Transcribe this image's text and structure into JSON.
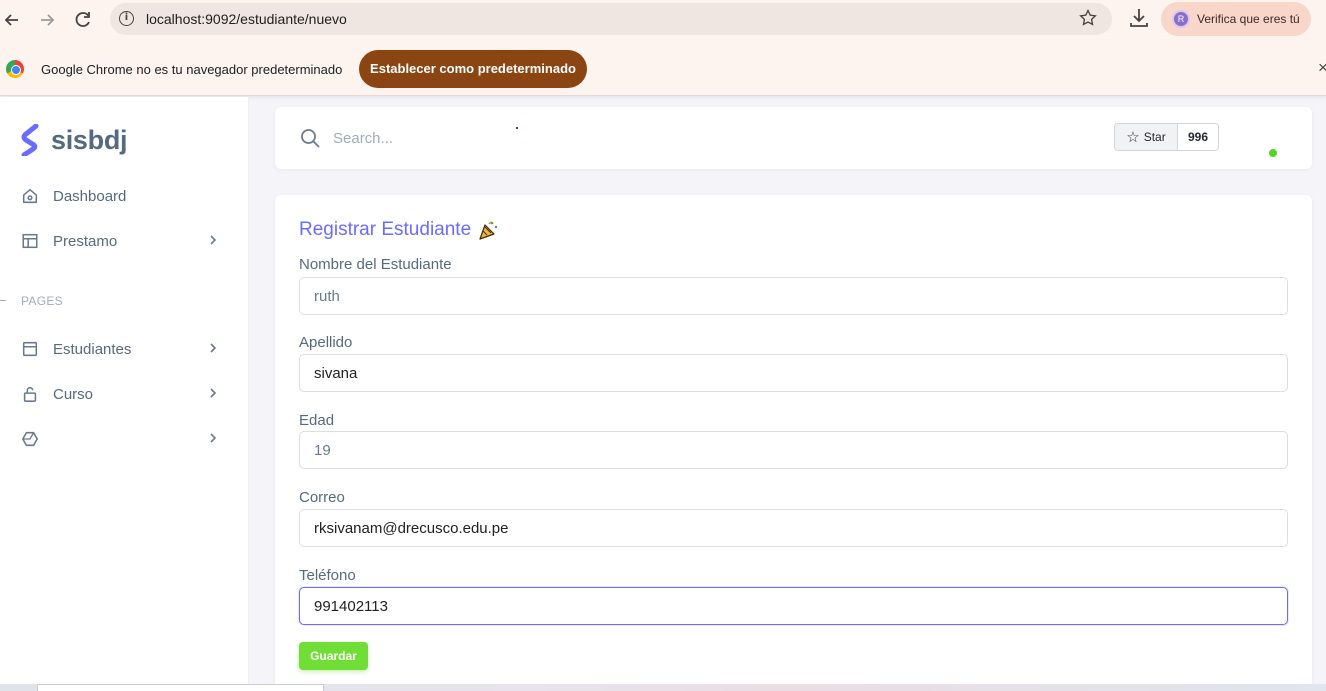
{
  "browser": {
    "url": "localhost:9092/estudiante/nuevo",
    "profile_chip_label": "Verifica que eres tú",
    "profile_initial": "R",
    "infobar_message": "Google Chrome no es tu navegador predeterminado",
    "infobar_button": "Establecer como predeterminado",
    "infobar_close": "×"
  },
  "sidebar": {
    "brand": "sisbdj",
    "items": [
      {
        "label": "Dashboard",
        "icon": "home-icon"
      },
      {
        "label": "Prestamo",
        "icon": "layout-icon"
      }
    ],
    "section_title": "PAGES",
    "page_items": [
      {
        "label": "Estudiantes",
        "icon": "window-icon"
      },
      {
        "label": "Curso",
        "icon": "lock-icon"
      },
      {
        "label": "",
        "icon": "cube-icon"
      }
    ]
  },
  "topbar": {
    "search_placeholder": "Search...",
    "star_label": "Star",
    "star_count": "996",
    "status_color": "#53d62a"
  },
  "form": {
    "title": "Registrar Estudiante",
    "fields": [
      {
        "label": "Nombre del Estudiante",
        "value": "ruth"
      },
      {
        "label": "Apellido",
        "value": "sivana"
      },
      {
        "label": "Edad",
        "value": "19"
      },
      {
        "label": "Correo",
        "value": "rksivanam@drecusco.edu.pe"
      },
      {
        "label": "Teléfono",
        "value": "991402113"
      }
    ],
    "submit_label": "Guardar",
    "accent_color": "#696cff",
    "submit_color": "#71dd37"
  }
}
